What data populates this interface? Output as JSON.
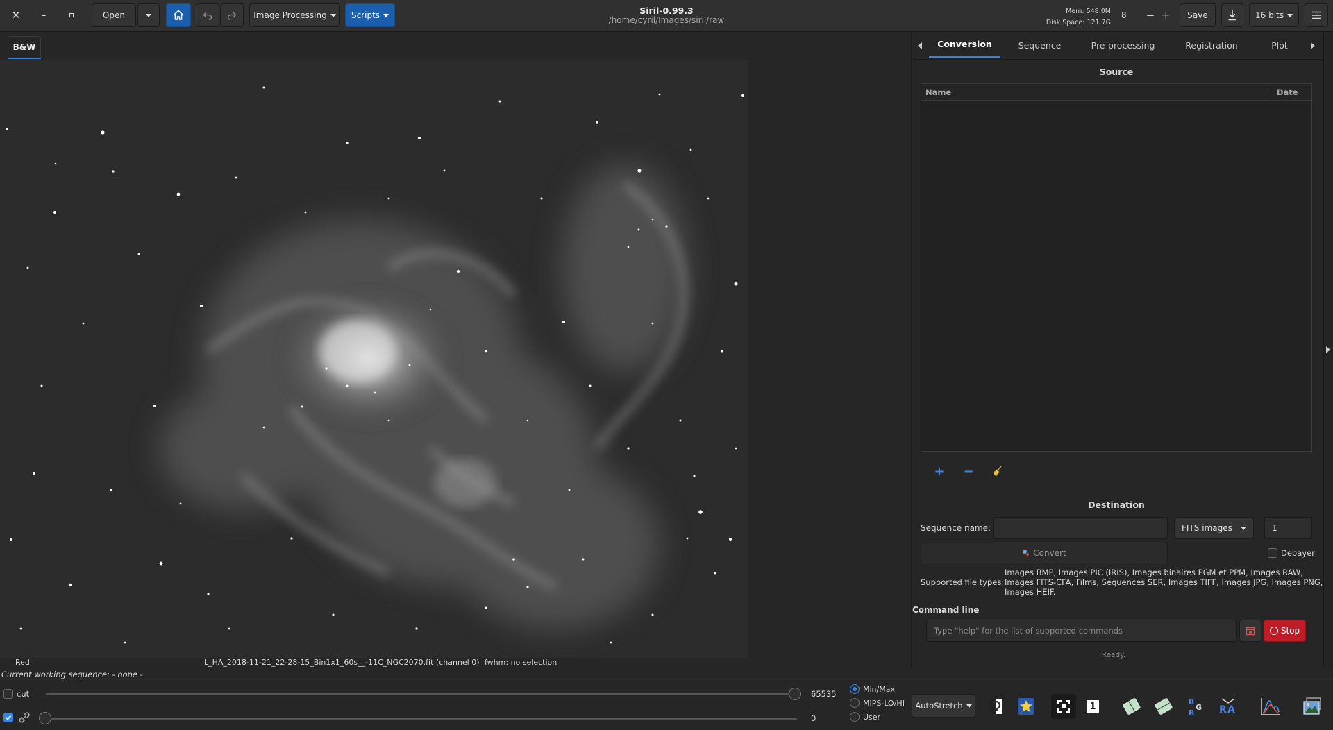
{
  "headerbar": {
    "title": "Siril-0.99.3",
    "subtitle": "/home/cyril/Images/siril/raw",
    "open_label": "Open",
    "image_processing_label": "Image Processing",
    "scripts_label": "Scripts",
    "mem_label": "Mem: 548.0M",
    "disk_label": "Disk Space: 121.7G",
    "threads_value": "8",
    "save_label": "Save",
    "bits_label": "16 bits"
  },
  "viewer": {
    "tab_label": "B&W",
    "channel_label": "Red",
    "file_info": "L_HA_2018-11-21_22-28-15_Bin1x1_60s__-11C_NGC2070.fit (channel 0)",
    "fwhm_info": "fwhm: no selection",
    "working_sequence": "Current working sequence: - none -"
  },
  "panel": {
    "tabs": [
      {
        "label": "Conversion",
        "active": true
      },
      {
        "label": "Sequence",
        "active": false
      },
      {
        "label": "Pre-processing",
        "active": false
      },
      {
        "label": "Registration",
        "active": false
      },
      {
        "label": "Plot",
        "active": false
      }
    ],
    "source_title": "Source",
    "col_name": "Name",
    "col_date": "Date",
    "destination_title": "Destination",
    "sequence_name_label": "Sequence name:",
    "sequence_name_value": "",
    "format_value": "FITS images",
    "start_index_value": "1",
    "convert_label": "Convert",
    "debayer_label": "Debayer",
    "supported_label": "Supported file types:",
    "supported_line1": "Images BMP, Images PIC (IRIS), Images binaires PGM et PPM, Images RAW,",
    "supported_line2": "Images FITS-CFA, Films, Séquences SER, Images TIFF, Images JPG, Images PNG,",
    "supported_line3": "Images HEIF."
  },
  "command": {
    "title": "Command line",
    "placeholder": "Type \"help\" for the list of supported commands",
    "stop_label": "Stop",
    "status": "Ready."
  },
  "bottom": {
    "cut_label": "cut",
    "hi_value": "65535",
    "lo_value": "0",
    "radio_minmax": "Min/Max",
    "radio_mips": "MIPS-LO/HI",
    "radio_user": "User",
    "stretch_label": "AutoStretch",
    "one_label": "1"
  },
  "colors": {
    "accent": "#3584e4",
    "stop": "#c01c28",
    "headerbar": "#303030"
  }
}
